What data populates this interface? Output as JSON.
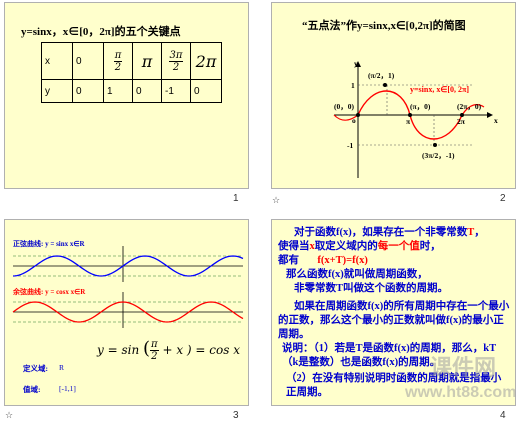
{
  "slide1": {
    "title": "y=sinx，x∈[0，2π]的五个关键点",
    "row_x": {
      "label": "x",
      "c1": "0",
      "c2n": "π",
      "c2d": "2",
      "c3": "π",
      "c4n": "3π",
      "c4d": "2",
      "c5": "2π"
    },
    "row_y": {
      "label": "y",
      "values": [
        "0",
        "1",
        "0",
        "-1",
        "0"
      ]
    },
    "page_number": "1"
  },
  "slide2": {
    "title": "“五点法”作y=sinx,x∈[0,2π]的简图",
    "curve_label": "y=sinx, x∈[0, 2π]",
    "points": {
      "p0": "(0，0)",
      "p1": "(π/2，1)",
      "p2": "(π，0)",
      "p3": "(3π/2，-1)",
      "p4": "(2π，0)"
    },
    "axis": {
      "y": "y",
      "x": "x",
      "o": "o",
      "one": "1",
      "neg_one": "-1",
      "pi": "π",
      "two_pi": "2π"
    },
    "page_number": "2",
    "star": "☆"
  },
  "slide3": {
    "sine_label": "正弦曲线: y = sinx    x∈R",
    "cosine_label": "余弦曲线: y = cosx    x∈R",
    "formula_lhs": "y = sin",
    "formula_n": "π",
    "formula_d": "2",
    "formula_rhs": "+ x ) = cos x",
    "domain_label": "定义域:",
    "domain_value": "R",
    "range_label": "值域:",
    "range_value": "[-1,1]",
    "page_number": "3",
    "star": "☆"
  },
  "slide4": {
    "line1a": "对于函数f(x)，如果存在一个非零常数",
    "line1b": "T",
    "line1c": "，",
    "line2a": "使得当",
    "line2b": "x",
    "line2c": "取定义域内的",
    "line2d": "每一个值",
    "line2e": "时，",
    "line3a": "都有",
    "line3b": "f(x+T)=f(x)",
    "line4": "那么函数f(x)就叫做周期函数，",
    "line5": "非零常数T叫做这个函数的周期。",
    "para2": "如果在周期函数f(x)的所有周期中存在一个最小的正数，那么这个最小的正数就叫做f(x)的最小正周期。",
    "note1": "说明：（1）若是T是函数f(x)的周期，那么，kT（k是整数）也是函数f(x)的周期。",
    "note2": "（2）在没有特别说明时函数的周期就是指最小正周期。",
    "page_number": "4"
  },
  "watermark": {
    "line1": "课件网",
    "line2": "www.ht88.com"
  },
  "colors": {
    "slide_bg": "#ffffcc",
    "curve_red": "#ff0000",
    "curve_blue": "#0000ff",
    "text_blue": "#0000cc"
  }
}
